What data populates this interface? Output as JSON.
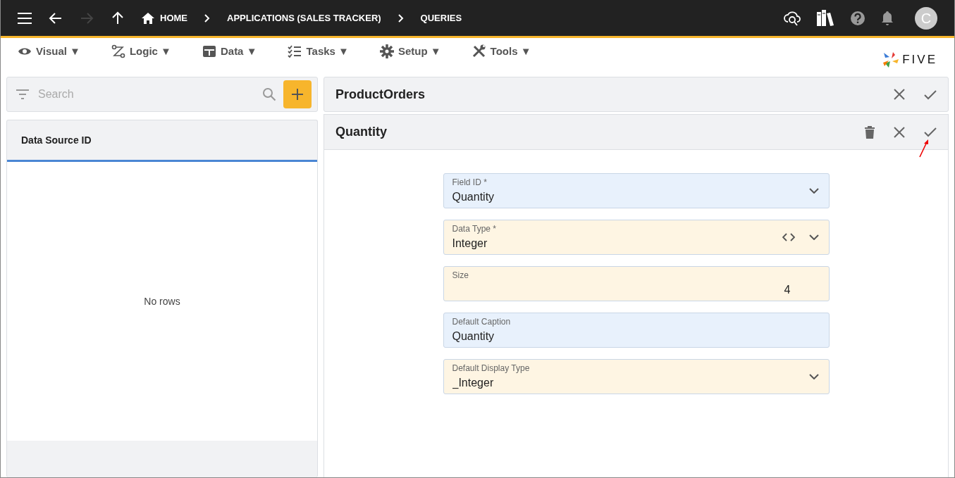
{
  "topbar": {
    "nav": [
      {
        "kind": "back",
        "disabled": false
      },
      {
        "kind": "forward",
        "disabled": true
      },
      {
        "kind": "up",
        "disabled": false
      }
    ],
    "breadcrumbs": [
      "HOME",
      "APPLICATIONS (SALES TRACKER)",
      "QUERIES"
    ],
    "avatar": "C"
  },
  "menu": [
    {
      "kind": "visual",
      "label": "Visual ▼"
    },
    {
      "kind": "logic",
      "label": "Logic ▼"
    },
    {
      "kind": "data",
      "label": "Data ▼"
    },
    {
      "kind": "tasks",
      "label": "Tasks ▼"
    },
    {
      "kind": "setup",
      "label": "Setup ▼"
    },
    {
      "kind": "tools",
      "label": "Tools ▼"
    }
  ],
  "logo": "FIVE",
  "left_panel": {
    "search": {
      "placeholder": "Search"
    },
    "table": {
      "columns": [
        "Data Source ID"
      ],
      "empty_text": "No rows"
    }
  },
  "record": {
    "title": "ProductOrders"
  },
  "detail": {
    "title": "Quantity",
    "fields": [
      {
        "label": "Field ID *",
        "value": "Quantity",
        "kind": "select",
        "color": "#e8f1fc"
      },
      {
        "label": "Data Type *",
        "value": "Integer",
        "kind": "select-code",
        "color": "#fef5e3"
      },
      {
        "label": "Size",
        "value": "4",
        "kind": "number",
        "color": "#fef5e3"
      },
      {
        "label": "Default Caption",
        "value": "Quantity",
        "kind": "text",
        "color": "#e8f1fc"
      },
      {
        "label": "Default Display Type",
        "value": "_Integer",
        "kind": "select",
        "color": "#fef5e3"
      }
    ]
  }
}
